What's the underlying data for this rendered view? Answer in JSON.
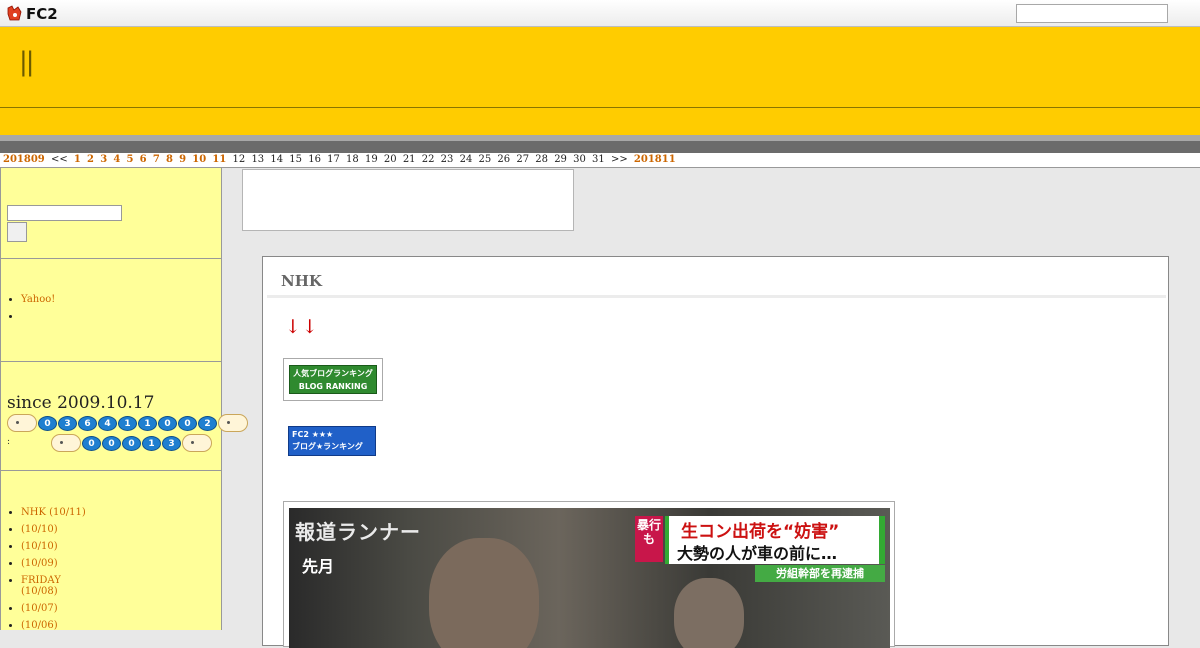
{
  "fc2bar": {
    "logo_text": "FC2",
    "search_value": ""
  },
  "header": {
    "title": "||"
  },
  "calendar": {
    "prev_month": "201809",
    "prev_nav": "<<",
    "linked_days": [
      "1",
      "2",
      "3",
      "4",
      "5",
      "6",
      "7",
      "8",
      "9",
      "10",
      "11"
    ],
    "plain_days": [
      "12",
      "13",
      "14",
      "15",
      "16",
      "17",
      "18",
      "19",
      "20",
      "21",
      "22",
      "23",
      "24",
      "25",
      "26",
      "27",
      "28",
      "29",
      "30",
      "31"
    ],
    "next_nav": ">>",
    "next_month": "201811"
  },
  "sidebar": {
    "search_value": "",
    "links": [
      {
        "label": "Yahoo!"
      },
      {
        "label": ""
      }
    ],
    "counter": {
      "since": "since 2009.10.17",
      "total_digits": [
        "0",
        "3",
        "6",
        "4",
        "1",
        "1",
        "0",
        "0",
        "2"
      ],
      "today_digits": [
        "0",
        "0",
        "0",
        "1",
        "3"
      ],
      "colon": ":"
    },
    "entries": [
      {
        "title": "NHK",
        "date": "(10/11)"
      },
      {
        "title": "",
        "date": "(10/10)"
      },
      {
        "title": "",
        "date": "(10/10)"
      },
      {
        "title": "",
        "date": "(10/09)"
      },
      {
        "title": "FRIDAY",
        "date": "(10/08)"
      },
      {
        "title": "",
        "date": "(10/07)"
      },
      {
        "title": "",
        "date": "(10/06)"
      }
    ]
  },
  "entry": {
    "title": "NHK",
    "arrows": "↓↓",
    "banner1": {
      "line1": "人気ブログランキング",
      "line2": "BLOG RANKING"
    },
    "banner2": {
      "line1": "FC2 ★★★",
      "line2": "ブログ★ランキング"
    },
    "photo": {
      "logo": "報道ランナー",
      "caption_time": "先月",
      "caption_tag": "暴行も",
      "caption_line1": "生コン出荷を“妨害”",
      "caption_line2": "大勢の人が車の前に…",
      "caption_sub": "労組幹部を再逮捕"
    }
  },
  "colors": {
    "header": "#ffcc00",
    "sidebar": "#ffff99",
    "link": "#cc6600",
    "arrow": "#cc0000"
  }
}
